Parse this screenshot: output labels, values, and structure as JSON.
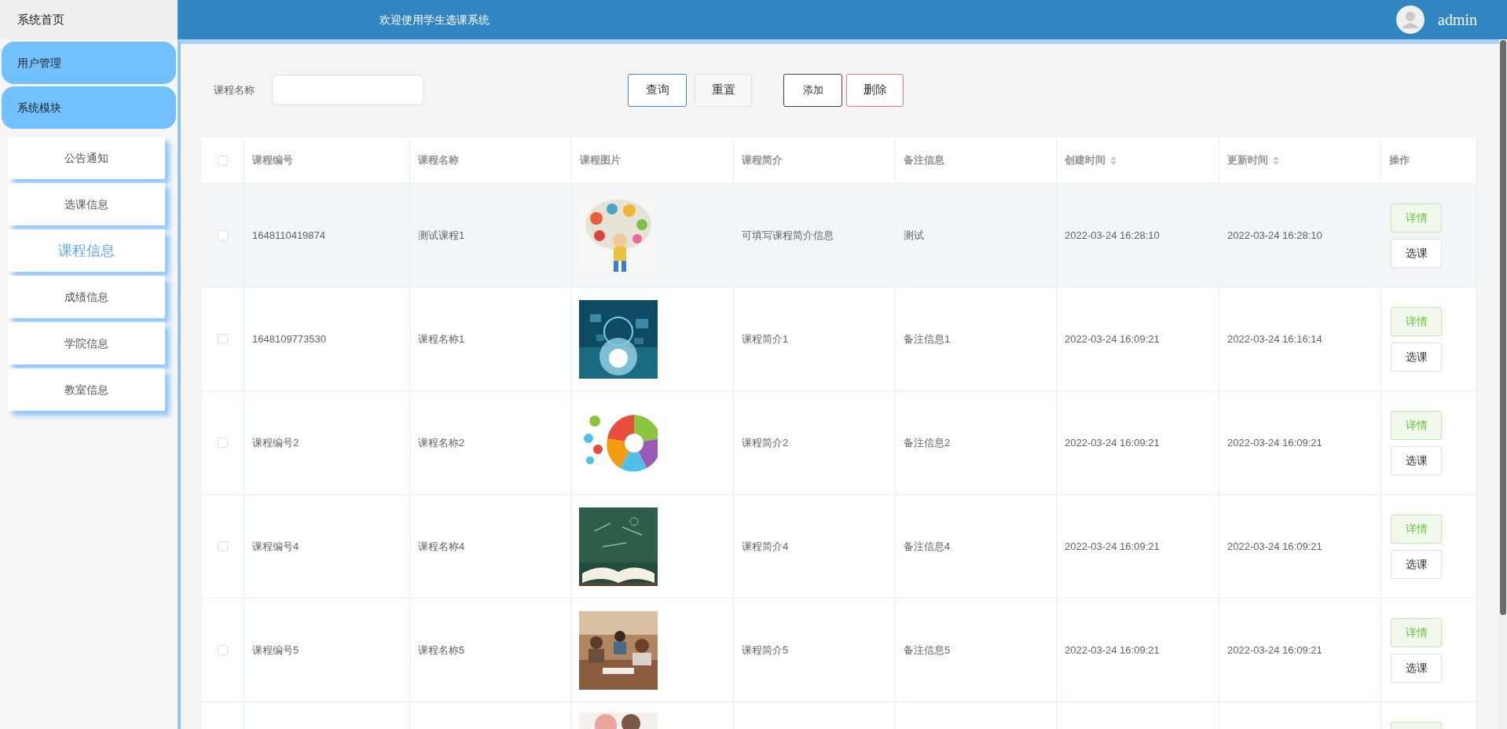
{
  "sidebar": {
    "home": "系统首页",
    "groups": [
      {
        "label": "用户管理"
      },
      {
        "label": "系统模块"
      }
    ],
    "items": [
      {
        "label": "公告通知",
        "selected": false
      },
      {
        "label": "选课信息",
        "selected": false
      },
      {
        "label": "课程信息",
        "selected": true
      },
      {
        "label": "成绩信息",
        "selected": false
      },
      {
        "label": "学院信息",
        "selected": false
      },
      {
        "label": "教室信息",
        "selected": false
      }
    ]
  },
  "header": {
    "title": "欢迎使用学生选课系统",
    "user": "admin"
  },
  "search": {
    "label": "课程名称"
  },
  "toolbar": [
    {
      "label": "查询",
      "kind": "primary"
    },
    {
      "label": "重置",
      "kind": "plain"
    },
    {
      "label": "添加",
      "kind": "dark"
    },
    {
      "label": "删除",
      "kind": "danger"
    }
  ],
  "table": {
    "select_all": {
      "checked": false
    },
    "columns": [
      {
        "label": "课程编号",
        "sortable": false
      },
      {
        "label": "课程名称",
        "sortable": false
      },
      {
        "label": "课程图片",
        "sortable": false
      },
      {
        "label": "课程简介",
        "sortable": false
      },
      {
        "label": "备注信息",
        "sortable": false
      },
      {
        "label": "创建时间",
        "sortable": true
      },
      {
        "label": "更新时间",
        "sortable": true
      },
      {
        "label": "操作",
        "sortable": false
      }
    ],
    "rows": [
      {
        "kind": "full",
        "checked": false,
        "hovered": true,
        "id": "1648110419874",
        "name": "测试课程1",
        "intro": "可填写课程简介信息",
        "note": "测试",
        "created": "2022-03-24 16:28:10",
        "updated": "2022-03-24 16:28:10",
        "actions": [
          "详情",
          "选课"
        ]
      },
      {
        "kind": "full",
        "checked": false,
        "hovered": false,
        "id": "1648109773530",
        "name": "课程名称1",
        "intro": "课程简介1",
        "note": "备注信息1",
        "created": "2022-03-24 16:09:21",
        "updated": "2022-03-24 16:16:14",
        "actions": [
          "详情",
          "选课"
        ]
      },
      {
        "kind": "full",
        "checked": false,
        "hovered": false,
        "id": "课程编号2",
        "name": "课程名称2",
        "intro": "课程简介2",
        "note": "备注信息2",
        "created": "2022-03-24 16:09:21",
        "updated": "2022-03-24 16:09:21",
        "actions": [
          "详情",
          "选课"
        ]
      },
      {
        "kind": "full",
        "checked": false,
        "hovered": false,
        "id": "课程编号4",
        "name": "课程名称4",
        "intro": "课程简介4",
        "note": "备注信息4",
        "created": "2022-03-24 16:09:21",
        "updated": "2022-03-24 16:09:21",
        "actions": [
          "详情",
          "选课"
        ]
      },
      {
        "kind": "full",
        "checked": false,
        "hovered": false,
        "id": "课程编号5",
        "name": "课程名称5",
        "intro": "课程简介5",
        "note": "备注信息5",
        "created": "2022-03-24 16:09:21",
        "updated": "2022-03-24 16:09:21",
        "actions": [
          "详情",
          "选课"
        ]
      },
      {
        "kind": "partial"
      }
    ]
  }
}
